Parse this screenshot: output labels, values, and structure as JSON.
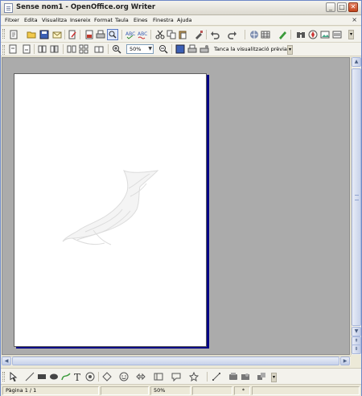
{
  "window": {
    "title": "Sense nom1 - OpenOffice.org Writer",
    "buttons": {
      "minimize": "_",
      "maximize": "□",
      "close": "✕"
    }
  },
  "menu": {
    "items": [
      {
        "label": "Fitxer"
      },
      {
        "label": "Edita"
      },
      {
        "label": "Visualitza"
      },
      {
        "label": "Insereix"
      },
      {
        "label": "Format"
      },
      {
        "label": "Taula"
      },
      {
        "label": "Eines"
      },
      {
        "label": "Finestra"
      },
      {
        "label": "Ajuda"
      }
    ],
    "close_glyph": "×"
  },
  "preview_toolbar": {
    "zoom_value": "50%",
    "close_preview_label": "Tanca la visualització prèvia"
  },
  "statusbar": {
    "page": "Pàgina  1 / 1",
    "zoom": "50%",
    "mode": "*"
  },
  "colors": {
    "page_border": "#000084",
    "workspace": "#ababab"
  }
}
